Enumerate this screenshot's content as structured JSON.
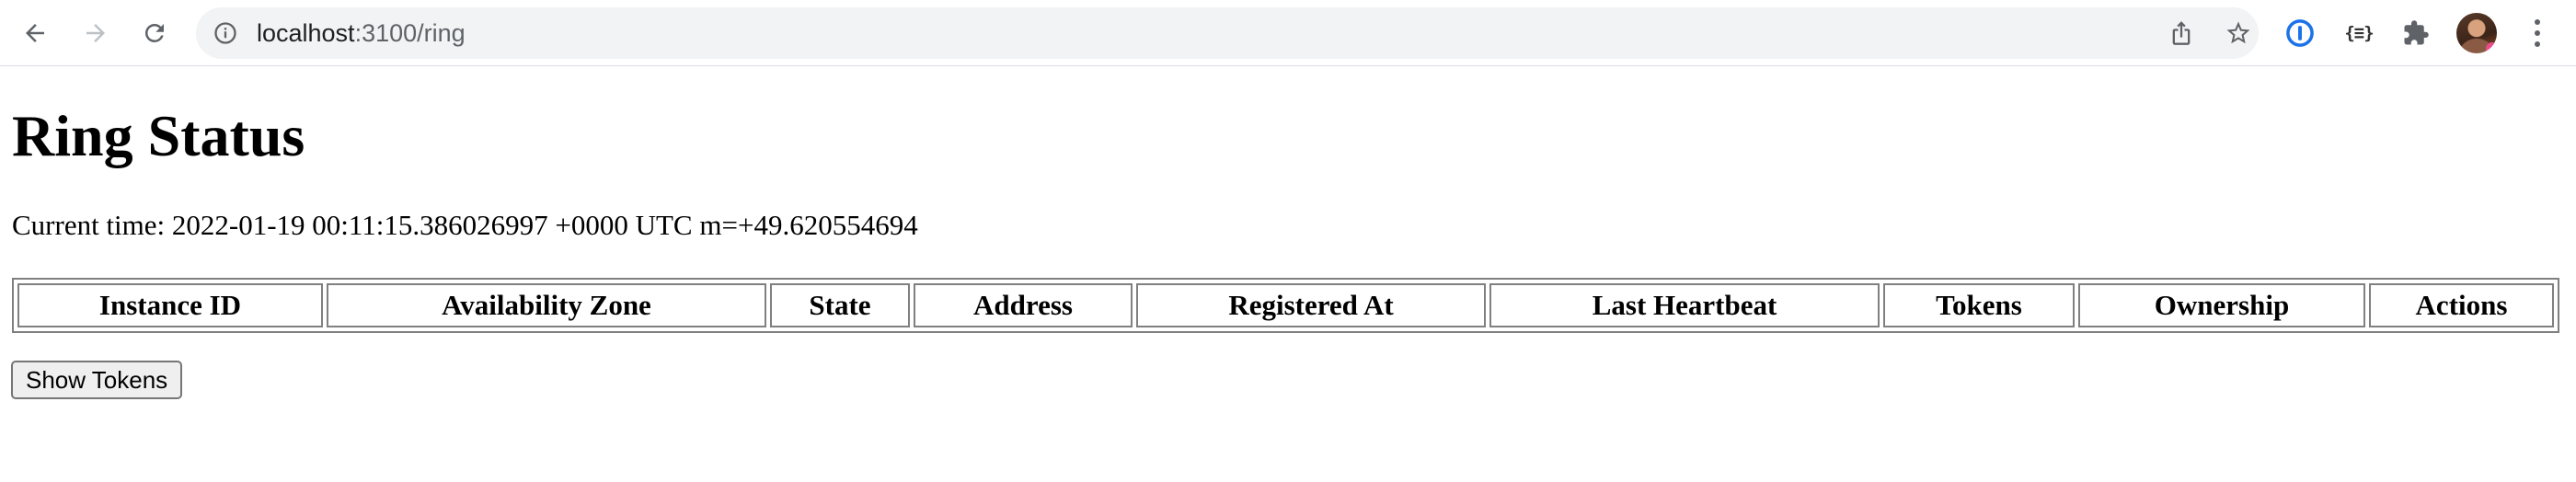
{
  "browser": {
    "url_host": "localhost",
    "url_path": ":3100/ring",
    "toolbar_icons": [
      "back-arrow-icon",
      "forward-arrow-icon",
      "reload-icon",
      "site-info-icon",
      "share-icon",
      "bookmark-star-icon",
      "password-manager-icon",
      "json-viewer-icon",
      "extensions-puzzle-icon",
      "profile-avatar",
      "more-menu-icon"
    ],
    "extension_braces": "{≡}"
  },
  "page": {
    "title": "Ring Status",
    "current_time_label": "Current time:",
    "current_time_value": "2022-01-19 00:11:15.386026997 +0000 UTC m=+49.620554694",
    "table": {
      "headers": [
        "Instance ID",
        "Availability Zone",
        "State",
        "Address",
        "Registered At",
        "Last Heartbeat",
        "Tokens",
        "Ownership",
        "Actions"
      ],
      "rows": []
    },
    "show_tokens_button": "Show Tokens"
  },
  "colors": {
    "omnibox_bg": "#f1f3f4",
    "toolbar_icon": "#5f6368",
    "table_border": "#808080",
    "password_manager_blue": "#1a73e8"
  }
}
